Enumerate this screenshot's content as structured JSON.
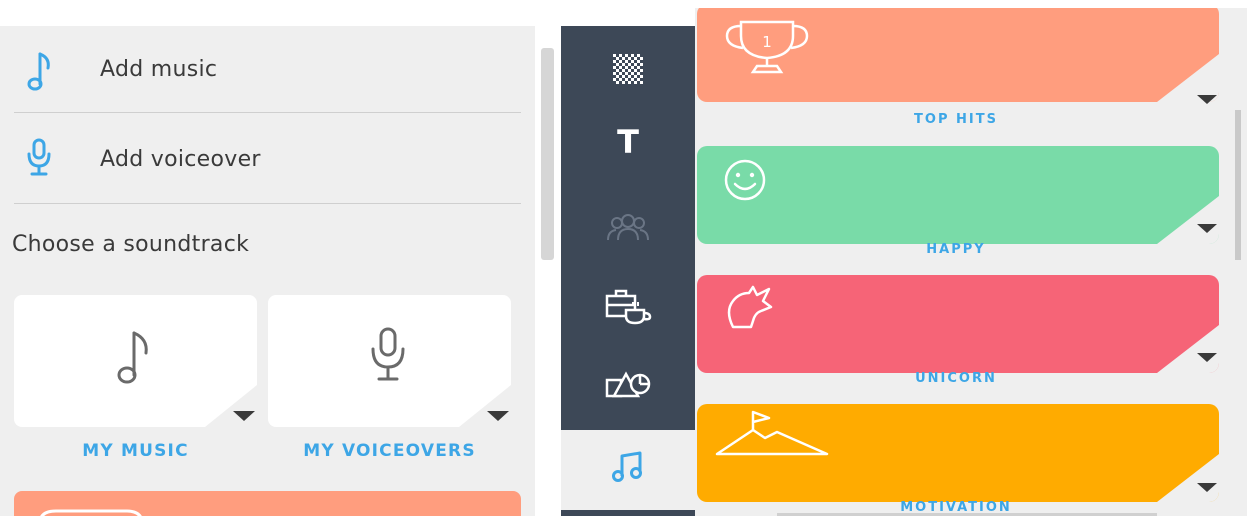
{
  "left_panel": {
    "add_music_label": "Add music",
    "add_voiceover_label": "Add voiceover",
    "section_title": "Choose a soundtrack",
    "cards": [
      {
        "label": "MY MUSIC",
        "icon": "music-note-icon"
      },
      {
        "label": "MY VOICEOVERS",
        "icon": "microphone-icon"
      }
    ],
    "accent_color": "#3da6e6",
    "partial_card_color": "#ff9d7e"
  },
  "toolbar": {
    "items": [
      {
        "icon": "checkerboard-icon"
      },
      {
        "icon": "text-icon",
        "label": "T"
      },
      {
        "icon": "people-icon"
      },
      {
        "icon": "briefcase-coffee-icon"
      },
      {
        "icon": "shapes-icon"
      },
      {
        "icon": "music-icon",
        "active": true
      }
    ],
    "background_color": "#3d4857",
    "active_icon_color": "#3da6e6"
  },
  "genres": [
    {
      "label": "TOP HITS",
      "color": "#ff9d7e",
      "icon": "trophy-icon"
    },
    {
      "label": "HAPPY",
      "color": "#79dba8",
      "icon": "smiley-icon"
    },
    {
      "label": "UNICORN",
      "color": "#f66477",
      "icon": "unicorn-icon"
    },
    {
      "label": "MOTIVATION",
      "color": "#ffab00",
      "icon": "mountain-flag-icon"
    }
  ]
}
